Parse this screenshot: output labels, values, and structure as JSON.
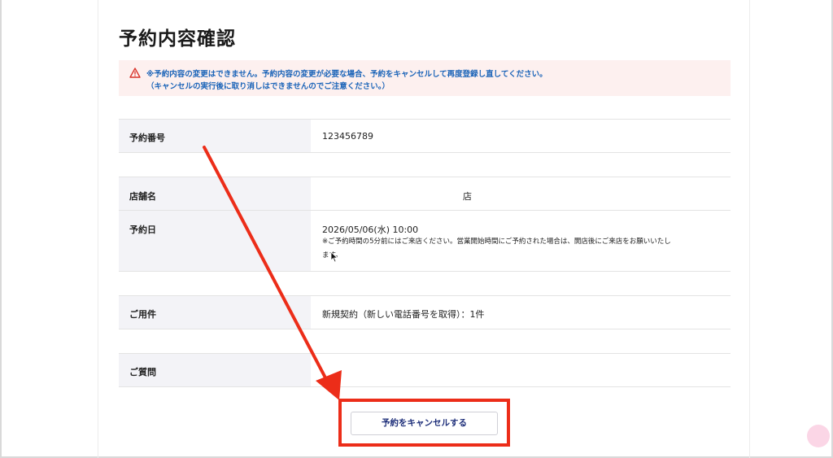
{
  "page": {
    "title": "予約内容確認"
  },
  "notice": {
    "line1": "※予約内容の変更はできません。予約内容の変更が必要な場合、予約をキャンセルして再度登録し直してください。",
    "line2": "（キャンセルの実行後に取り消しはできませんのでご注意ください。）",
    "icon": "warning-triangle-icon",
    "text_color": "#1a63b8",
    "background": "#fdf0ef"
  },
  "details": {
    "reservation_number": {
      "label": "予約番号",
      "value": "123456789"
    },
    "store": {
      "label": "店舗名",
      "value": "店"
    },
    "date": {
      "label": "予約日",
      "value": "2026/05/06(水) 10:00",
      "note_line1": "※ご予約時間の5分前にはご来店ください。営業開始時間にご予約された場合は、開店後にご来店をお願いいたし",
      "note_line2": "ます。"
    },
    "purpose": {
      "label": "ご用件",
      "value": "新規契約（新しい電話番号を取得）：1件"
    },
    "question": {
      "label": "ご質問",
      "value": ""
    }
  },
  "actions": {
    "cancel_label": "予約をキャンセルする"
  },
  "annotation": {
    "highlight_color": "#ec2d19"
  }
}
